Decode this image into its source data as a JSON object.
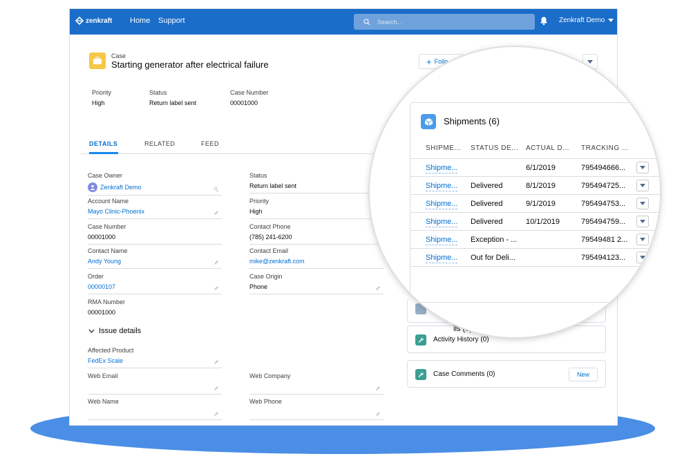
{
  "topbar": {
    "brand": "zenkraft",
    "nav": [
      "Home",
      "Support"
    ],
    "search_placeholder": "Search...",
    "user_name": "Zenkraft Demo"
  },
  "header": {
    "object_label": "Case",
    "title": "Starting generator after electrical failure",
    "follow_label": "Follo",
    "highlights": [
      {
        "label": "Priority",
        "value": "High"
      },
      {
        "label": "Status",
        "value": "Return label sent"
      },
      {
        "label": "Case Number",
        "value": "00001000"
      }
    ]
  },
  "tabs": [
    "DETAILS",
    "RELATED",
    "FEED"
  ],
  "details": {
    "case_owner": {
      "label": "Case Owner",
      "value": "Zenkraft Demo"
    },
    "status": {
      "label": "Status",
      "value": "Return label sent"
    },
    "account_name": {
      "label": "Account Name",
      "value": "Mayo Clinic-Phoenix"
    },
    "priority": {
      "label": "Priority",
      "value": "High"
    },
    "case_number": {
      "label": "Case Number",
      "value": "00001000"
    },
    "contact_phone": {
      "label": "Contact Phone",
      "value": "(785) 241-6200"
    },
    "contact_name": {
      "label": "Contact Name",
      "value": "Andy Young"
    },
    "contact_email": {
      "label": "Contact Email",
      "value": "mike@zenkraft.com"
    },
    "order": {
      "label": "Order",
      "value": "00000107"
    },
    "case_origin": {
      "label": "Case Origin",
      "value": "Phone"
    },
    "rma_number": {
      "label": "RMA Number",
      "value": "00001000"
    },
    "section_issue": "Issue details",
    "affected_product": {
      "label": "Affected Product",
      "value": "FedEx Scale"
    },
    "web_email": {
      "label": "Web Email",
      "value": ""
    },
    "web_company": {
      "label": "Web Company",
      "value": ""
    },
    "web_name": {
      "label": "Web Name",
      "value": ""
    },
    "web_phone": {
      "label": "Web Phone",
      "value": ""
    }
  },
  "related": {
    "emails_partial": "ils (0)",
    "activity_history": "Activity History (0)",
    "case_comments": "Case Comments (0)",
    "new_label": "New"
  },
  "shipments": {
    "title": "Shipments (6)",
    "columns": [
      "SHIPME...",
      "STATUS DE...",
      "ACTUAL D...",
      "TRACKING ..."
    ],
    "rows": [
      [
        "Shipme...",
        "",
        "6/1/2019",
        "795494666..."
      ],
      [
        "Shipme...",
        "Delivered",
        "8/1/2019",
        "795494725..."
      ],
      [
        "Shipme...",
        "Delivered",
        "9/1/2019",
        "795494753..."
      ],
      [
        "Shipme...",
        "Delivered",
        "10/1/2019",
        "795494759..."
      ],
      [
        "Shipme...",
        "Exception - ...",
        "",
        "79549481 2..."
      ],
      [
        "Shipme...",
        "Out for Deli...",
        "",
        "795494123..."
      ]
    ]
  },
  "colors": {
    "topbar": "#1a6dc9",
    "link": "#0070d2",
    "ellipse": "#4a8ee6",
    "case_icon": "#f5c847"
  }
}
